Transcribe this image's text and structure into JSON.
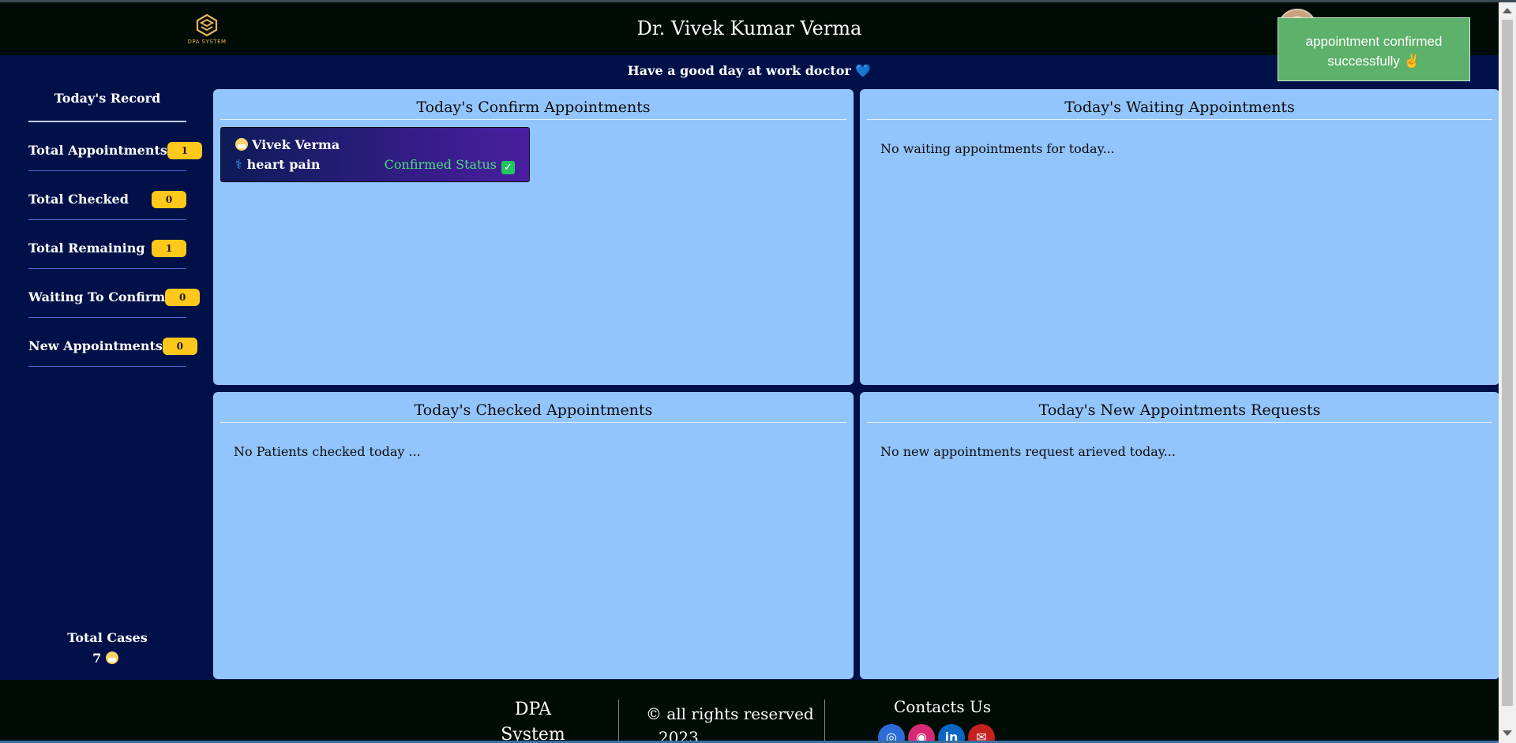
{
  "header": {
    "logo_text": "DPA SYSTEM",
    "doctor_name": "Dr. Vivek Kumar Verma"
  },
  "toast": {
    "message": "appointment confirmed successfully ✌"
  },
  "greeting": {
    "text": "Have a good day at work doctor",
    "heart": "💙"
  },
  "sidebar": {
    "title": "Today's Record",
    "stats": [
      {
        "label": "Total Appointments",
        "value": "1"
      },
      {
        "label": "Total Checked",
        "value": "0"
      },
      {
        "label": "Total Remaining",
        "value": "1"
      },
      {
        "label": "Waiting To Confirm",
        "value": "0"
      },
      {
        "label": "New Appointments",
        "value": "0"
      }
    ],
    "total_cases_label": "Total Cases",
    "total_cases_value": "7"
  },
  "panels": {
    "confirm": {
      "title": "Today's Confirm Appointments",
      "appointment": {
        "patient": "Vivek Verma",
        "reason_icon": "⚕",
        "reason": "heart pain",
        "status": "Confirmed Status",
        "status_icon": "✓"
      }
    },
    "waiting": {
      "title": "Today's Waiting Appointments",
      "empty": "No waiting appointments for today..."
    },
    "checked": {
      "title": "Today's Checked Appointments",
      "empty": "No Patients checked today ..."
    },
    "new_requests": {
      "title": "Today's New Appointments Requests",
      "empty": "No new appointments request arieved today..."
    }
  },
  "footer": {
    "brand_line1": "DPA",
    "brand_line2": "System",
    "rights_line1": "© all rights reserved",
    "rights_line2": "2023",
    "contacts_title": "Contacts Us",
    "icons": [
      {
        "name": "website-icon",
        "glyph": "◎",
        "color": "#2b6cd6"
      },
      {
        "name": "instagram-icon",
        "glyph": "◉",
        "color": "#d62976"
      },
      {
        "name": "linkedin-icon",
        "glyph": "in",
        "color": "#0a66c2"
      },
      {
        "name": "gmail-icon",
        "glyph": "✉",
        "color": "#c5221f"
      }
    ]
  },
  "colors": {
    "page_bg": "#00114a",
    "header_bg": "#000c05",
    "panel_bg": "#93c5fd",
    "badge_bg": "#ffc81a",
    "toast_bg": "#5db16b",
    "status_green": "#4ade80"
  }
}
